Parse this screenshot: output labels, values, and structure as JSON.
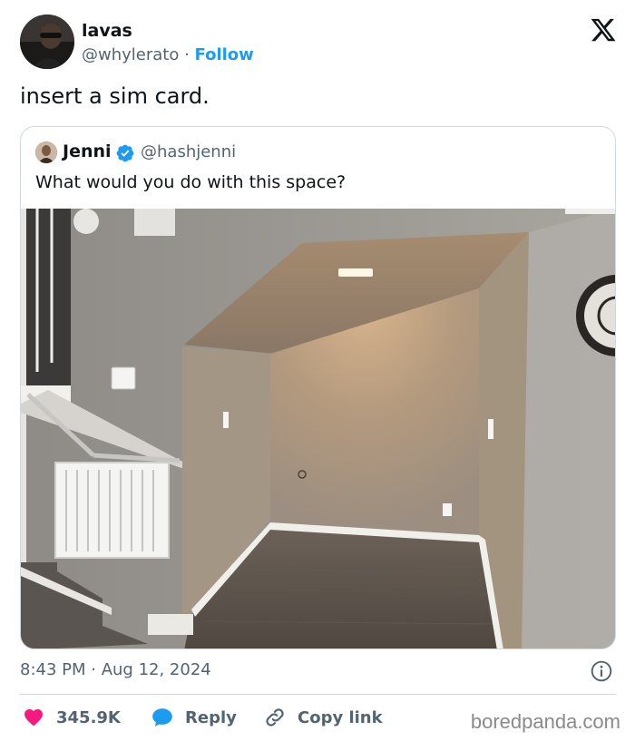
{
  "author": {
    "name": "lavas",
    "handle": "@whylerato",
    "separator": " · ",
    "follow_label": "Follow"
  },
  "tweet": {
    "text": "insert a sim card."
  },
  "quoted": {
    "name": "Jenni",
    "handle": "@hashjenni",
    "text": "What would you do with this space?",
    "verified_color": "#1d9bf0"
  },
  "meta": {
    "time": "8:43 PM",
    "separator": " · ",
    "date": "Aug 12, 2024"
  },
  "actions": {
    "like_count": "345.9K",
    "reply_label": "Reply",
    "copy_label": "Copy link"
  },
  "watermark": "boredpanda.com",
  "colors": {
    "accent": "#1d9bf0",
    "like": "#f91880",
    "muted": "#536471",
    "border": "#cfd9de"
  },
  "icons": [
    "x-logo-icon",
    "verified-badge-icon",
    "info-icon",
    "heart-icon",
    "reply-bubble-icon",
    "link-icon"
  ]
}
